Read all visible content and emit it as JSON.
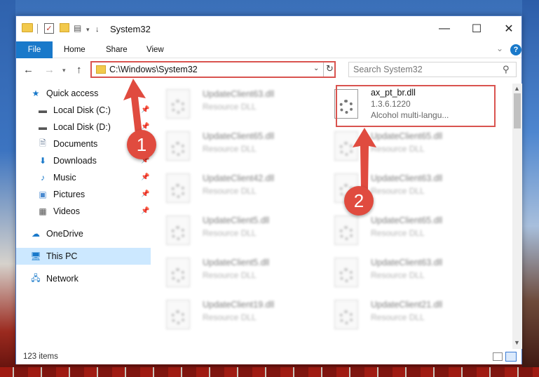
{
  "window": {
    "title": "System32"
  },
  "ribbon": {
    "tabs": [
      "File",
      "Home",
      "Share",
      "View"
    ]
  },
  "address": {
    "path": "C:\\Windows\\System32"
  },
  "search": {
    "placeholder": "Search System32"
  },
  "navpane": {
    "items": [
      {
        "label": "Quick access",
        "icon": "star-icon",
        "pinned": false
      },
      {
        "label": "Local Disk (C:)",
        "icon": "drive-icon",
        "pinned": true
      },
      {
        "label": "Local Disk (D:)",
        "icon": "drive-icon",
        "pinned": true
      },
      {
        "label": "Documents",
        "icon": "document-icon",
        "pinned": true
      },
      {
        "label": "Downloads",
        "icon": "download-icon",
        "pinned": true
      },
      {
        "label": "Music",
        "icon": "music-icon",
        "pinned": true
      },
      {
        "label": "Pictures",
        "icon": "picture-icon",
        "pinned": true
      },
      {
        "label": "Videos",
        "icon": "video-icon",
        "pinned": true
      },
      {
        "label": "OneDrive",
        "icon": "cloud-icon",
        "pinned": false
      },
      {
        "label": "This PC",
        "icon": "computer-icon",
        "pinned": false,
        "selected": true
      },
      {
        "label": "Network",
        "icon": "network-icon",
        "pinned": false
      }
    ]
  },
  "files": {
    "left": [
      {
        "name": "UpdateClient63.dll",
        "desc": "Resource DLL"
      },
      {
        "name": "UpdateClient65.dll",
        "desc": "Resource DLL"
      },
      {
        "name": "UpdateClient42.dll",
        "desc": "Resource DLL"
      },
      {
        "name": "UpdateClient5.dll",
        "desc": "Resource DLL"
      },
      {
        "name": "UpdateClient5.dll",
        "desc": "Resource DLL"
      },
      {
        "name": "UpdateClient19.dll",
        "desc": "Resource DLL"
      }
    ],
    "right": [
      {
        "name": "ax_pt_br.dll",
        "version": "1.3.6.1220",
        "desc": "Alcohol multi-langu..."
      },
      {
        "name": "UpdateClient65.dll",
        "desc": "Resource DLL"
      },
      {
        "name": "UpdateClient63.dll",
        "desc": "Resource DLL"
      },
      {
        "name": "UpdateClient65.dll",
        "desc": "Resource DLL"
      },
      {
        "name": "UpdateClient63.dll",
        "desc": "Resource DLL"
      },
      {
        "name": "UpdateClient21.dll",
        "desc": "Resource DLL"
      }
    ]
  },
  "status": {
    "item_count": "123 items"
  },
  "callouts": [
    "1",
    "2"
  ],
  "colors": {
    "accent": "#1979ca",
    "highlight": "#d9534f",
    "callout": "#e04b3f"
  }
}
